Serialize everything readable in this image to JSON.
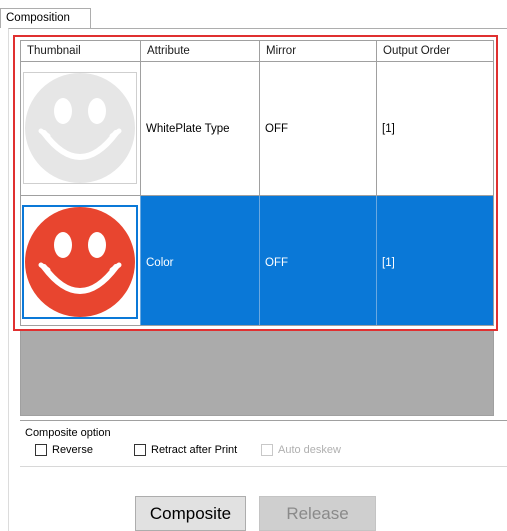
{
  "tab": {
    "label": "Composition"
  },
  "grid": {
    "columns": [
      "Thumbnail",
      "Attribute",
      "Mirror",
      "Output Order"
    ],
    "rows": [
      {
        "thumbnail": "smiley-white-icon",
        "attribute": "WhitePlate Type",
        "mirror": "OFF",
        "output_order": "[1]",
        "selected": false
      },
      {
        "thumbnail": "smiley-color-icon",
        "attribute": "Color",
        "mirror": "OFF",
        "output_order": "[1]",
        "selected": true
      }
    ]
  },
  "options": {
    "label": "Composite option",
    "reverse": "Reverse",
    "retract": "Retract after Print",
    "deskew": "Auto deskew"
  },
  "buttons": {
    "composite": "Composite",
    "release": "Release"
  },
  "colors": {
    "selection": "#0a78d7",
    "highlight_frame": "#e03030",
    "smiley_color": "#e8452f",
    "smiley_white": "#e6e6e6"
  }
}
